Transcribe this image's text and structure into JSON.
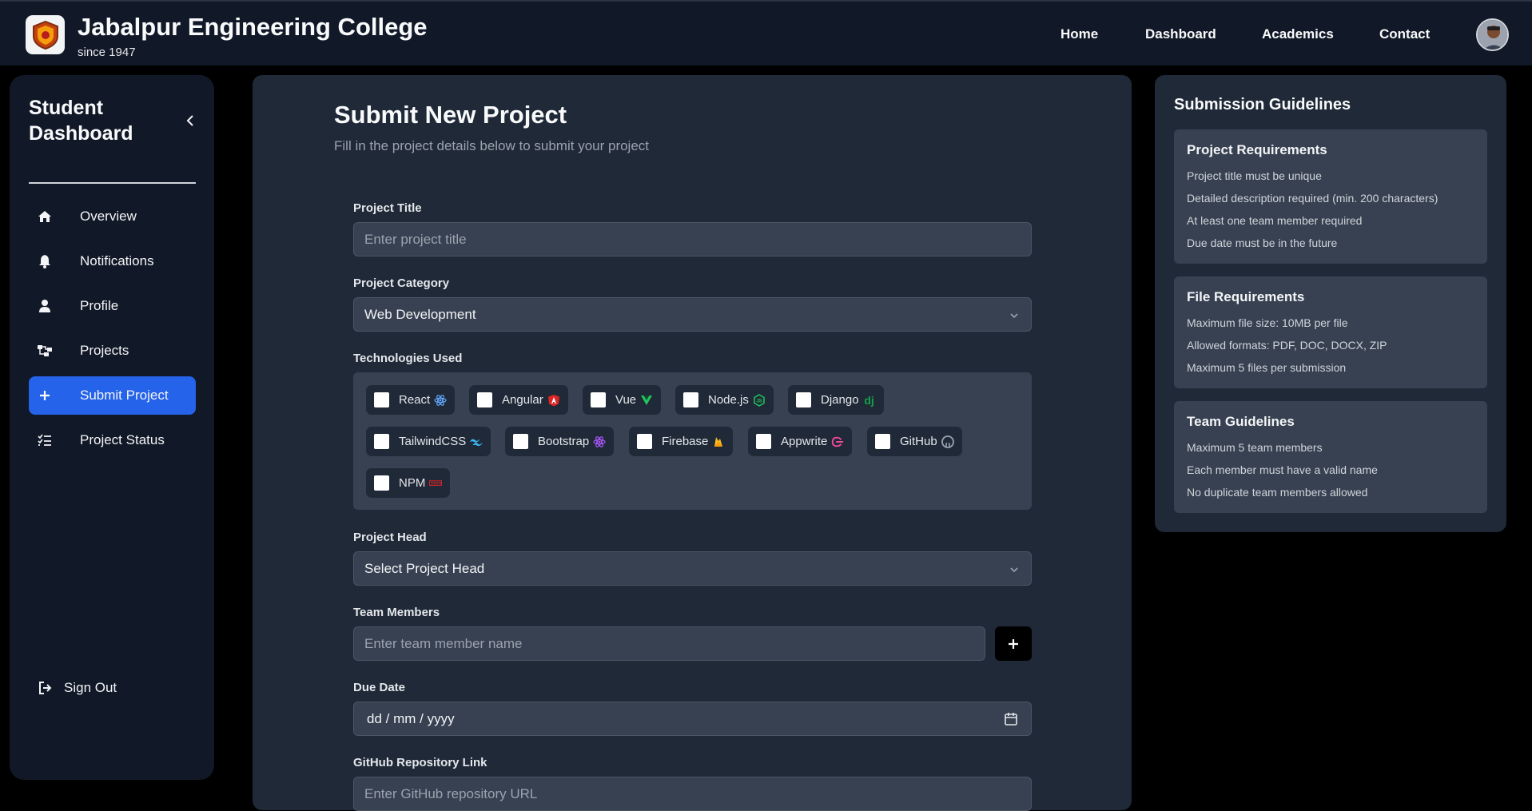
{
  "header": {
    "title": "Jabalpur Engineering College",
    "subtitle": "since 1947",
    "nav": [
      "Home",
      "Dashboard",
      "Academics",
      "Contact"
    ]
  },
  "sidebar": {
    "title": "Student Dashboard",
    "items": [
      {
        "label": "Overview",
        "icon": "home-icon"
      },
      {
        "label": "Notifications",
        "icon": "bell-icon"
      },
      {
        "label": "Profile",
        "icon": "user-icon"
      },
      {
        "label": "Projects",
        "icon": "project-tree-icon"
      },
      {
        "label": "Submit Project",
        "icon": "plus-icon",
        "active": true
      },
      {
        "label": "Project Status",
        "icon": "checklist-icon"
      }
    ],
    "signout": "Sign Out"
  },
  "form": {
    "title": "Submit New Project",
    "subtitle": "Fill in the project details below to submit your project",
    "project_title_label": "Project Title",
    "project_title_placeholder": "Enter project title",
    "category_label": "Project Category",
    "category_value": "Web Development",
    "tech_label": "Technologies Used",
    "technologies": [
      "React",
      "Angular",
      "Vue",
      "Node.js",
      "Django",
      "TailwindCSS",
      "Bootstrap",
      "Firebase",
      "Appwrite",
      "GitHub",
      "NPM"
    ],
    "head_label": "Project Head",
    "head_value": "Select Project Head",
    "team_label": "Team Members",
    "team_placeholder": "Enter team member name",
    "due_label": "Due Date",
    "due_placeholder": "dd / mm / yyyy",
    "github_label": "GitHub Repository Link",
    "github_placeholder": "Enter GitHub repository URL"
  },
  "guidelines": {
    "title": "Submission Guidelines",
    "sections": [
      {
        "heading": "Project Requirements",
        "items": [
          "Project title must be unique",
          "Detailed description required (min. 200 characters)",
          "At least one team member required",
          "Due date must be in the future"
        ]
      },
      {
        "heading": "File Requirements",
        "items": [
          "Maximum file size: 10MB per file",
          "Allowed formats: PDF, DOC, DOCX, ZIP",
          "Maximum 5 files per submission"
        ]
      },
      {
        "heading": "Team Guidelines",
        "items": [
          "Maximum 5 team members",
          "Each member must have a valid name",
          "No duplicate team members allowed"
        ]
      }
    ]
  }
}
